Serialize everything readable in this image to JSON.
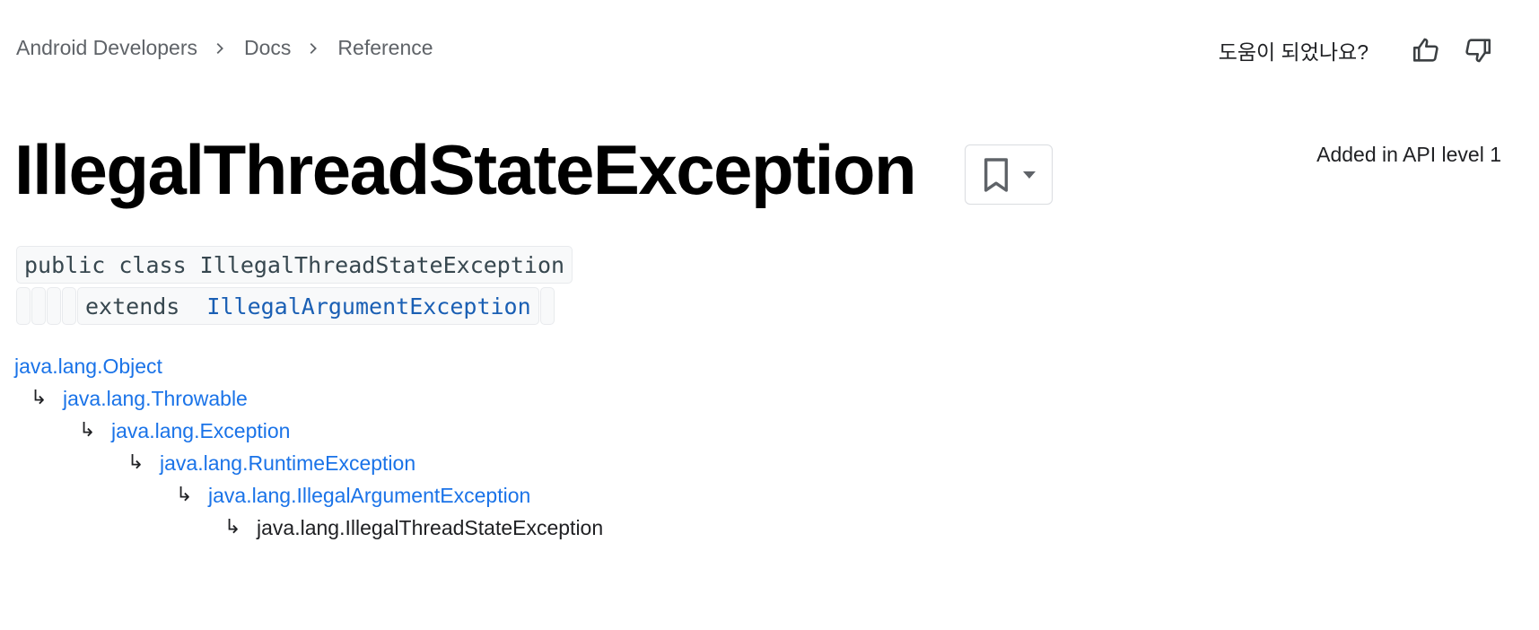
{
  "breadcrumb": {
    "items": [
      {
        "label": "Android Developers"
      },
      {
        "label": "Docs"
      },
      {
        "label": "Reference"
      }
    ],
    "separator_icon": "chevron-right-icon"
  },
  "feedback": {
    "question": "도움이 되었나요?",
    "like_icon": "thumb-up-icon",
    "dislike_icon": "thumb-down-icon"
  },
  "header": {
    "title": "IllegalThreadStateException",
    "bookmark_icon": "bookmark-icon",
    "dropdown_icon": "caret-down-icon",
    "api_level": "Added in API level 1"
  },
  "signature": {
    "line1": "public class IllegalThreadStateException",
    "extends_keyword": "extends",
    "extends_class": "IllegalArgumentException"
  },
  "hierarchy": {
    "arrow": "↳",
    "items": [
      {
        "label": "java.lang.Object",
        "link": true
      },
      {
        "label": "java.lang.Throwable",
        "link": true
      },
      {
        "label": "java.lang.Exception",
        "link": true
      },
      {
        "label": "java.lang.RuntimeException",
        "link": true
      },
      {
        "label": "java.lang.IllegalArgumentException",
        "link": true
      },
      {
        "label": "java.lang.IllegalThreadStateException",
        "link": false
      }
    ]
  },
  "colors": {
    "link": "#1a73e8",
    "text": "#202124",
    "muted": "#5f6368",
    "code_bg": "#f8f9fa",
    "code_border": "#e8eaed"
  }
}
